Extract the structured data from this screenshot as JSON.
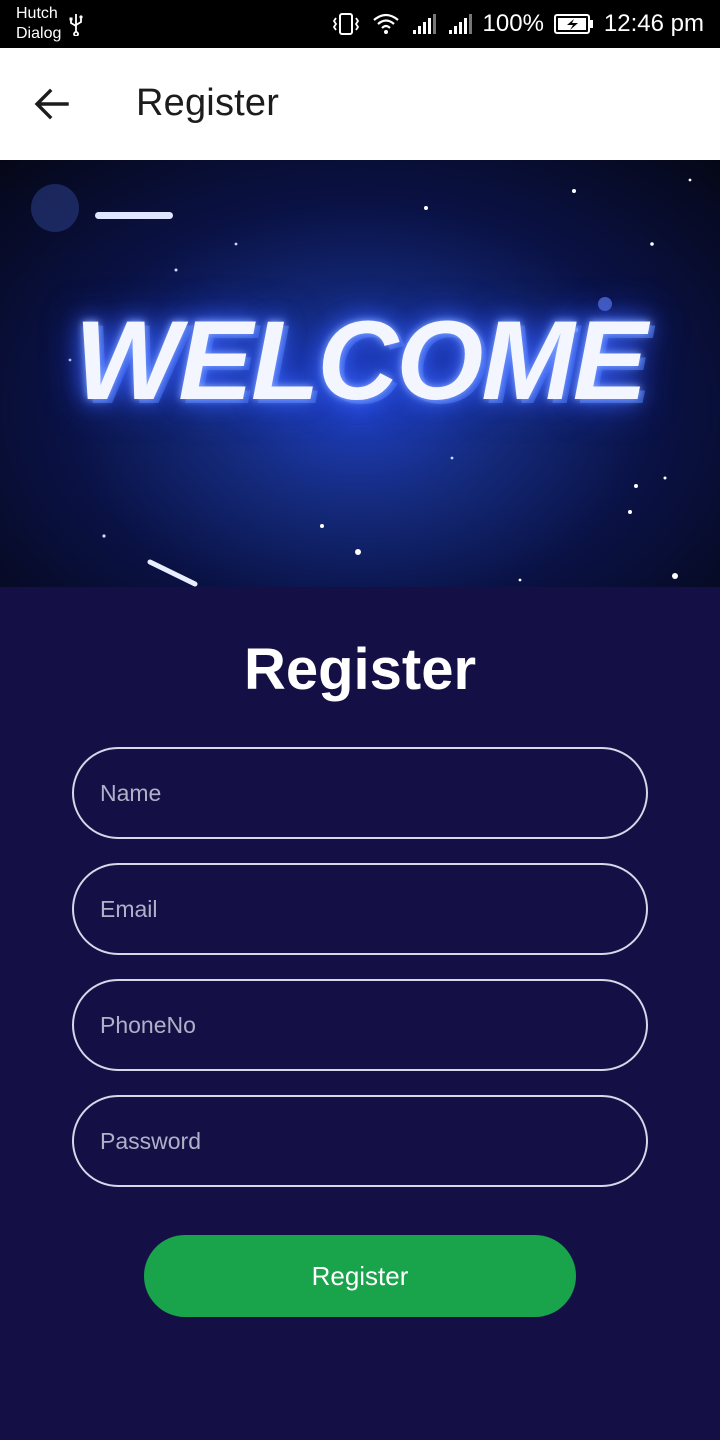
{
  "status_bar": {
    "carrier_1": "Hutch",
    "carrier_2": "Dialog",
    "battery_percent": "100%",
    "time": "12:46 pm"
  },
  "app_bar": {
    "title": "Register"
  },
  "banner": {
    "text": "WELCOME"
  },
  "form": {
    "title": "Register",
    "fields": [
      {
        "placeholder": "Name",
        "value": ""
      },
      {
        "placeholder": "Email",
        "value": ""
      },
      {
        "placeholder": "PhoneNo",
        "value": ""
      },
      {
        "placeholder": "Password",
        "value": ""
      }
    ],
    "submit_label": "Register"
  },
  "colors": {
    "background": "#141046",
    "button": "#19a34a",
    "field_border": "#d8d6e8"
  }
}
